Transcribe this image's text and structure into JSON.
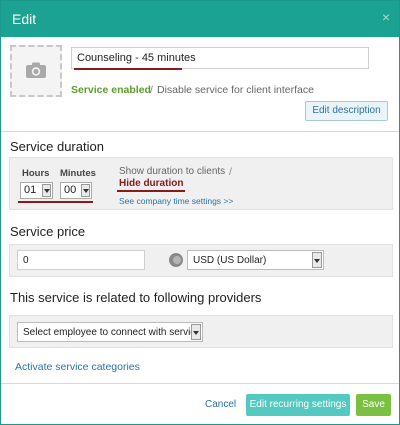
{
  "dialog": {
    "title": "Edit",
    "close_symbol": "×"
  },
  "service": {
    "name": "Counseling - 45 minutes",
    "photo_icon": "camera-icon",
    "enabled_label": "Service enabled",
    "separator": "/",
    "disable_label": "Disable service for client interface",
    "edit_description_label": "Edit description"
  },
  "duration": {
    "section_title": "Service duration",
    "hours_label": "Hours",
    "minutes_label": "Minutes",
    "hours_value": "01",
    "minutes_value": "00",
    "show_label": "Show duration to clients",
    "separator": "/",
    "hide_label": "Hide duration",
    "company_settings_link": "See company time settings >>"
  },
  "price": {
    "section_title": "Service price",
    "value": "0",
    "currency_icon": "coins-icon",
    "currency": "USD (US Dollar)"
  },
  "providers": {
    "section_title": "This service is related to following providers",
    "select_placeholder": "Select employee to connect with service"
  },
  "categories_link": "Activate service categories",
  "footer": {
    "cancel_label": "Cancel",
    "recurring_label": "Edit recurring settings",
    "save_label": "Save"
  },
  "colors": {
    "header": "#1ca292",
    "enabled": "#5a9e2c",
    "highlight_underline": "#8b1a1a",
    "link": "#2a72a8",
    "recurring_button": "#54c9c0",
    "save_button": "#7ac143"
  }
}
